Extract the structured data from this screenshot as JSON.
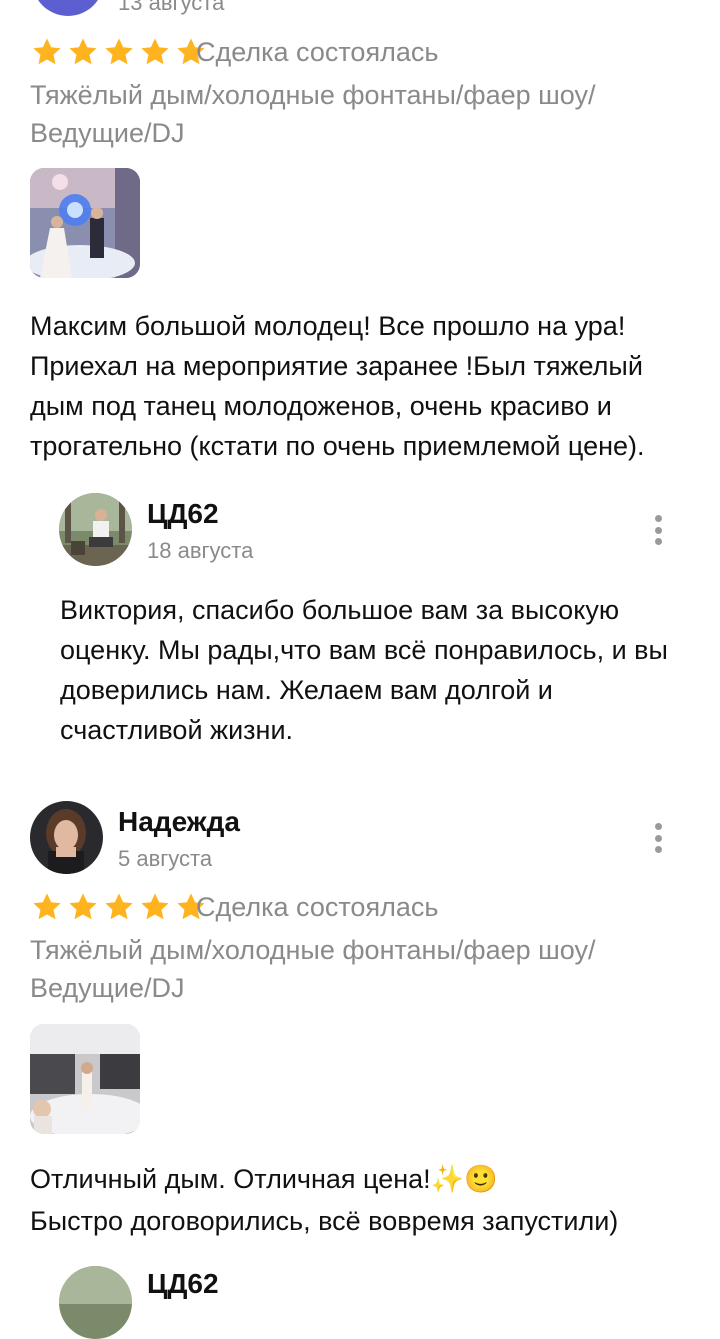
{
  "review1": {
    "date_partial": "13 августа",
    "status": "Сделка состоялась",
    "category": "Тяжёлый дым/холодные фонтаны/фаер шоу/ Ведущие/DJ",
    "text": "Максим большой молодец! Все прошло на ура! Приехал на мероприятие заранее !Был тяжелый дым под танец молодоженов, очень красиво и трогательно (кстати по очень приемлемой цене).",
    "rating": 5
  },
  "reply1": {
    "name": "ЦД62",
    "date": "18 августа",
    "text": "Виктория, спасибо большое вам за высокую оценку. Мы рады,что вам всё понравилось, и вы доверились нам. Желаем вам долгой и счастливой жизни."
  },
  "review2": {
    "name": "Надежда",
    "date": "5 августа",
    "status": "Сделка состоялась",
    "category": "Тяжёлый дым/холодные фонтаны/фаер шоу/ Ведущие/DJ",
    "text_line1": "Отличный дым. Отличная цена!✨🙂",
    "text_line2": "Быстро договорились, всё вовремя запустили)",
    "rating": 5
  },
  "reply2_partial": {
    "name_partial": "ЦД62"
  },
  "colors": {
    "star": "#ffb41f",
    "muted_text": "#8a8a8a",
    "text": "#111111",
    "menu_dots": "#9a9a9a",
    "avatar_purple": "#5d5fd0"
  },
  "icons": {
    "rating": "star-icon",
    "more": "more-vertical-icon"
  }
}
